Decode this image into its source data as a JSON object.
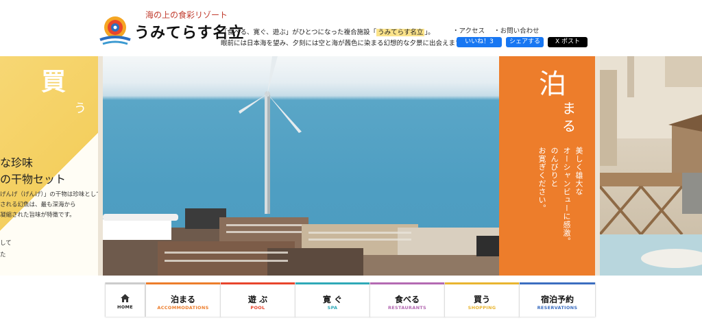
{
  "header": {
    "logo_tagline": "海の上の食彩リゾート",
    "logo_name": "うみてらす名立",
    "intro_line1_before": "「食べる、寛ぐ、遊ぶ」がひとつになった複合施設「",
    "intro_line1_highlight": "うみてらす名立",
    "intro_line1_after": "」。",
    "intro_line2": "眼前には日本海を望み、夕刻には空と海が茜色に染まる幻想的な夕景に出会えます。",
    "links": [
      "・アクセス",
      "・お問い合わせ"
    ],
    "fb_like": "いいね！3",
    "fb_share": "シェアする",
    "x_post": "X ポスト"
  },
  "banner": {
    "buy_card": {
      "title": "買",
      "title_sub": "う",
      "line1": "な珍味",
      "line2": "の干物セット",
      "desc": "げんげ（げんげ）」の干物は珍味として逸品です。\nされる幻魚は、最も深海から\n凝縮された旨味が特徴です。",
      "extra": "して\nた"
    },
    "stay_card": {
      "title": "泊",
      "title_sub1": "ま",
      "title_sub2": "る",
      "columns": [
        "美しく雄大な",
        "オーシャンビューに感激。",
        "のんびりと",
        "お寛ぎください。"
      ]
    }
  },
  "nav": [
    {
      "label": "HOME",
      "sub": "",
      "color": "#cccccc",
      "icon": "home-icon"
    },
    {
      "label": "泊まる",
      "sub": "ACCOMMODATIONS",
      "color": "#ed7d2b"
    },
    {
      "label": "遊 ぶ",
      "sub": "POOL",
      "color": "#e8452c"
    },
    {
      "label": "寛 ぐ",
      "sub": "SPA",
      "color": "#2fa9b8"
    },
    {
      "label": "食べる",
      "sub": "RESTAURANTS",
      "color": "#b46ab2"
    },
    {
      "label": "買う",
      "sub": "SHOPPING",
      "color": "#e9b530"
    },
    {
      "label": "宿泊予約",
      "sub": "RESERVATIONS",
      "color": "#3c6ec0"
    }
  ]
}
